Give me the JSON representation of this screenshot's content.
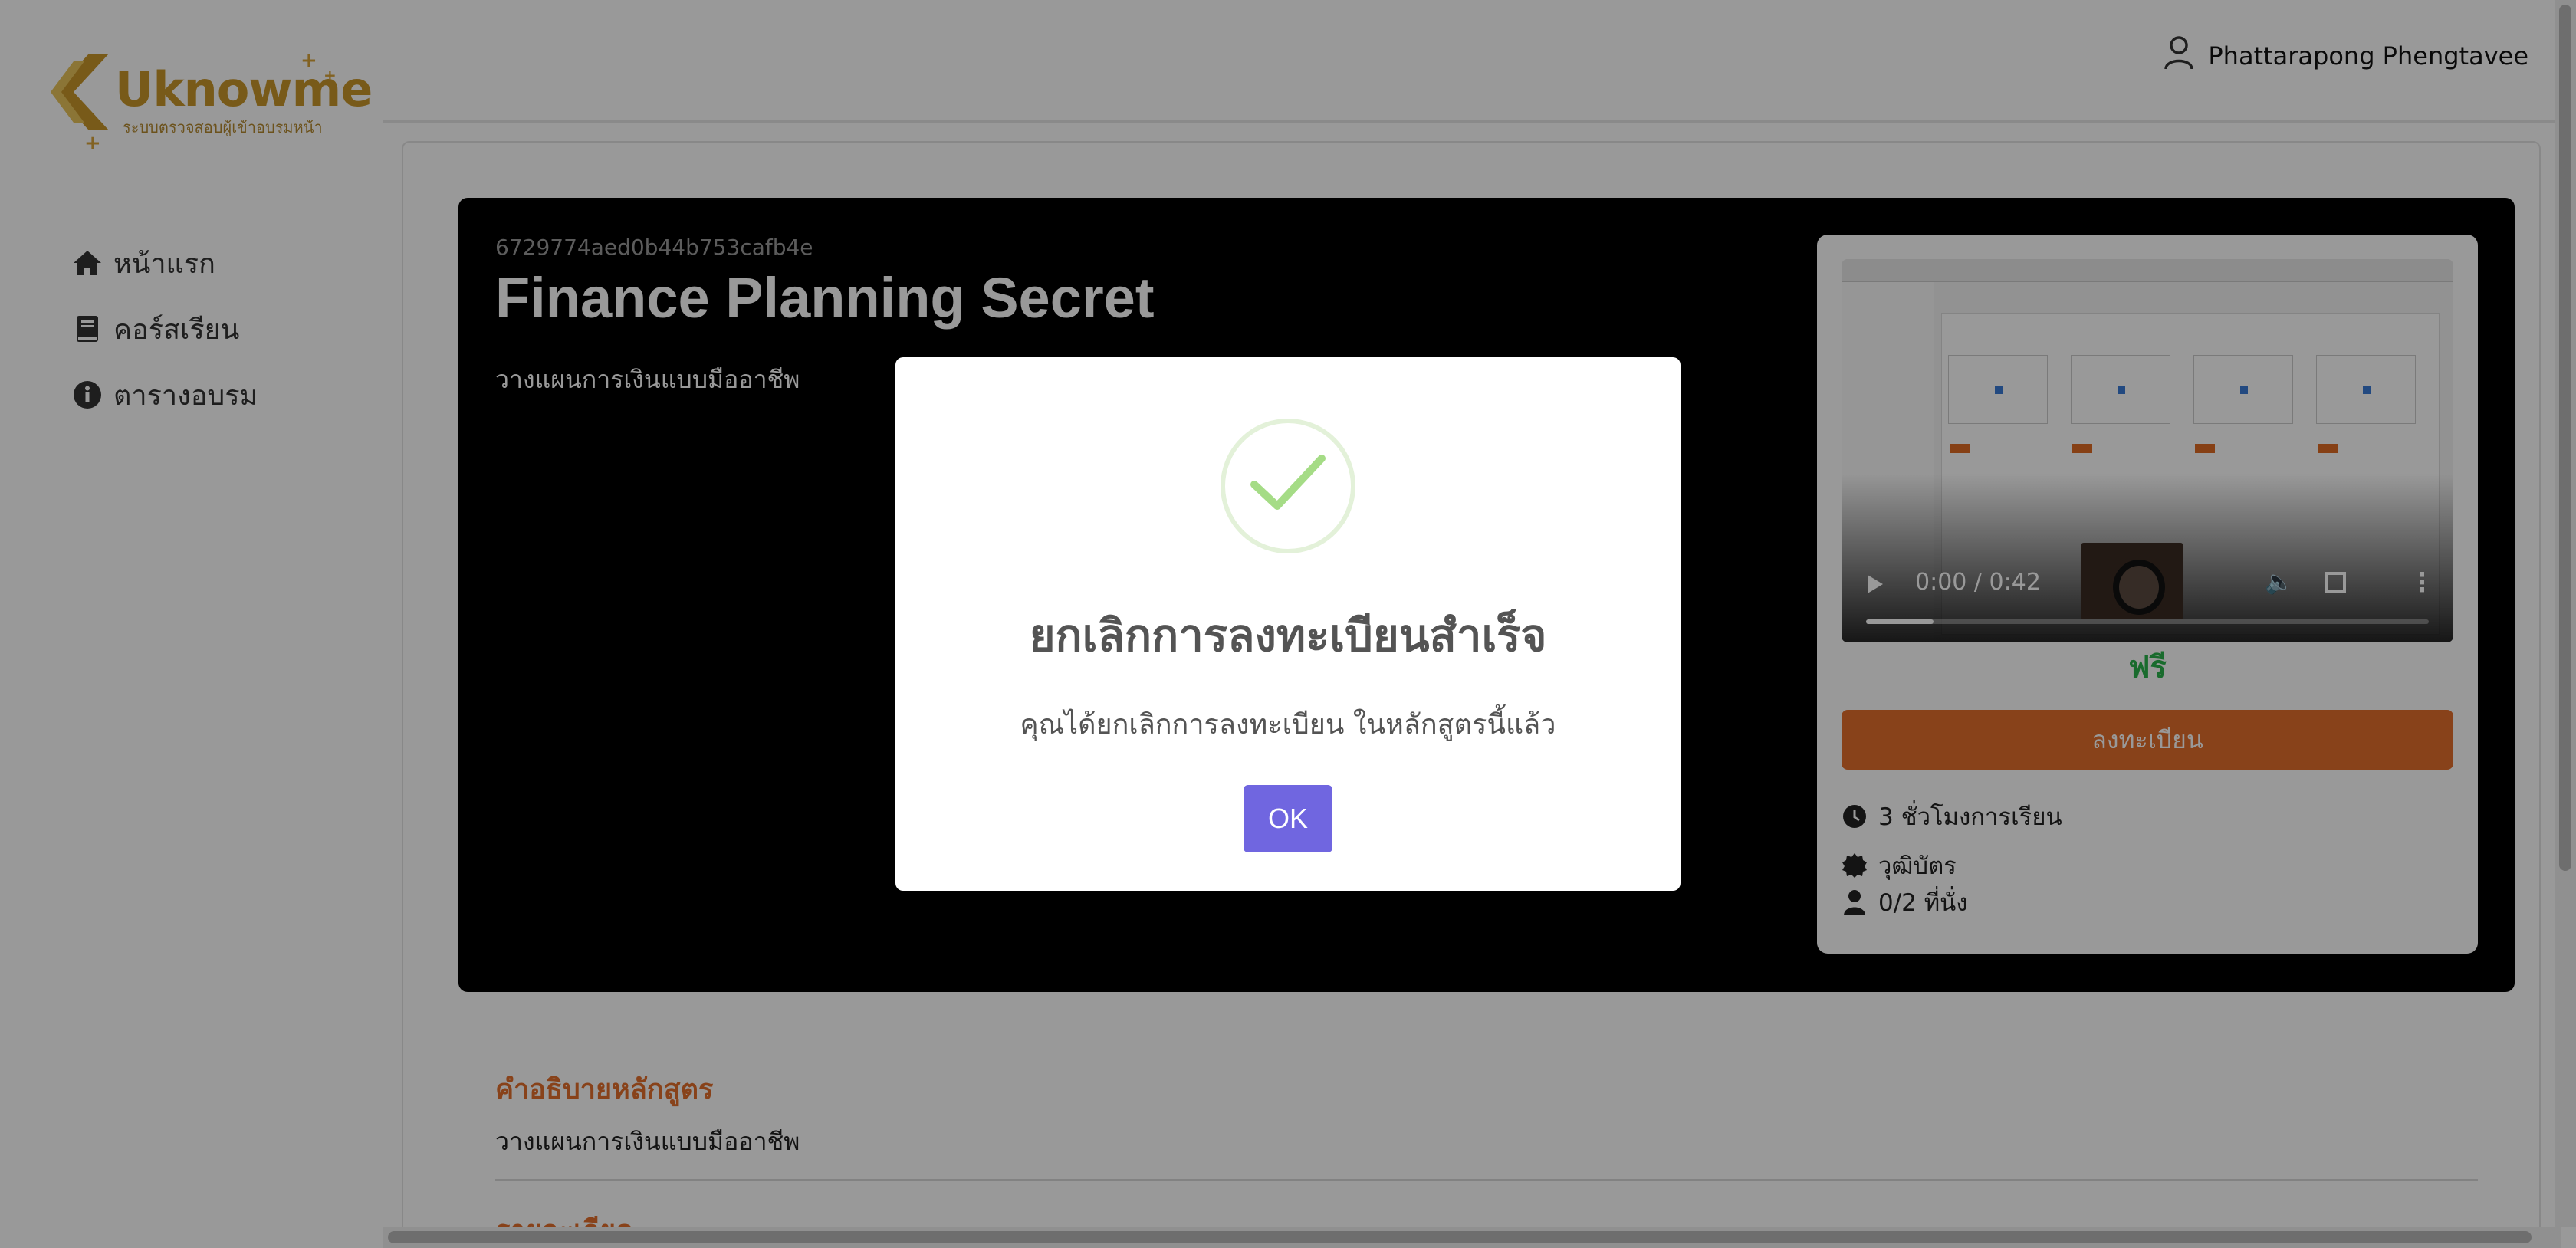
{
  "brand": {
    "logo_text": "Uknowme",
    "logo_subtitle": "ระบบตรวจสอบผู้เข้าอบรมหน้า"
  },
  "sidebar": {
    "items": [
      {
        "label": "หน้าแรก",
        "icon": "home-icon"
      },
      {
        "label": "คอร์สเรียน",
        "icon": "book-icon"
      },
      {
        "label": "ตารางอบรม",
        "icon": "info-icon"
      }
    ]
  },
  "header": {
    "user_name": "Phattarapong Phengtavee"
  },
  "course": {
    "id": "6729774aed0b44b753cafb4e",
    "title": "Finance Planning Secret",
    "subtitle": "วางแผนการเงินแบบมืออาชีพ",
    "price": "ฟรี",
    "enroll_label": "ลงทะเบียน",
    "hours": "3 ชั่วโมงการเรียน",
    "certificate": "วุฒิบัตร",
    "seats": "0/2 ที่นั่ง",
    "video": {
      "time": "0:00 / 0:42",
      "progress": 0.12
    },
    "description_title": "คำอธิบายหลักสูตร",
    "description_text": "วางแผนการเงินแบบมืออาชีพ",
    "details_title": "รายละเอียด"
  },
  "modal": {
    "title": "ยกเลิกการลงทะเบียนสำเร็จ",
    "text": "คุณได้ยกเลิกการลงทะเบียน ในหลักสูตรนี้แล้ว",
    "ok_label": "OK",
    "icon": "checkmark-icon",
    "accent_color": "#7066e0",
    "success_color": "#a5dc86"
  },
  "colors": {
    "primary_orange": "#e36f2c",
    "price_green": "#2bb24c",
    "brand_gold": "#c9972b"
  }
}
